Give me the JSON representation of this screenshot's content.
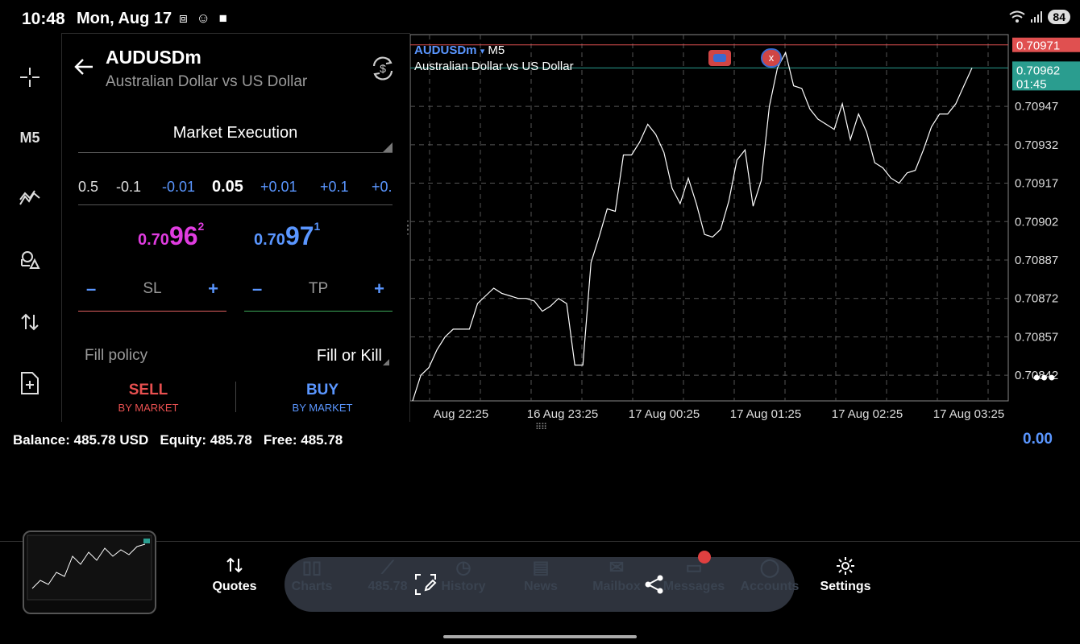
{
  "status_bar": {
    "time": "10:48",
    "date": "Mon, Aug 17",
    "battery": "84"
  },
  "toolbar": {
    "timeframe": "M5"
  },
  "order_panel": {
    "symbol": "AUDUSDm",
    "description": "Australian Dollar vs US Dollar",
    "execution": "Market Execution",
    "volume_steps": [
      "0.5",
      "-0.1",
      "-0.01",
      "0.05",
      "+0.01",
      "+0.1",
      "+0."
    ],
    "bid": {
      "prefix": "0.70",
      "big": "96",
      "sup": "2"
    },
    "ask": {
      "prefix": "0.70",
      "big": "97",
      "sup": "1"
    },
    "sl_label": "SL",
    "tp_label": "TP",
    "minus": "–",
    "plus": "+",
    "fill_policy_label": "Fill policy",
    "fill_policy_value": "Fill or Kill",
    "sell": {
      "label": "SELL",
      "sub": "BY MARKET"
    },
    "buy": {
      "label": "BUY",
      "sub": "BY MARKET"
    }
  },
  "chart_header": {
    "symbol": "AUDUSDm",
    "arrow": "▾",
    "timeframe": "M5",
    "description": "Australian Dollar vs US Dollar"
  },
  "chart_data": {
    "type": "line",
    "y_ticks": [
      "0.70947",
      "0.70932",
      "0.70917",
      "0.70902",
      "0.70887",
      "0.70872",
      "0.70857",
      "0.70842"
    ],
    "y_tick_values": [
      0.70947,
      0.70932,
      0.70917,
      0.70902,
      0.70887,
      0.70872,
      0.70857,
      0.70842
    ],
    "ylim": [
      0.70832,
      0.70975
    ],
    "x_ticks": [
      "Aug 22:25",
      "16 Aug 23:25",
      "17 Aug 00:25",
      "17 Aug 01:25",
      "17 Aug 02:25",
      "17 Aug 03:25"
    ],
    "ask_line": {
      "value": "0.70971",
      "color": "#e05050"
    },
    "bid_line": {
      "value": "0.70962",
      "countdown": "01:45",
      "color": "#2a9d8f"
    },
    "values": [
      0.70832,
      0.70842,
      0.70845,
      0.70852,
      0.70857,
      0.7086,
      0.7086,
      0.7086,
      0.7087,
      0.70873,
      0.70876,
      0.70874,
      0.70873,
      0.70872,
      0.70872,
      0.70871,
      0.70867,
      0.70869,
      0.70872,
      0.7087,
      0.70846,
      0.70846,
      0.70886,
      0.70896,
      0.70907,
      0.70906,
      0.70928,
      0.70928,
      0.70933,
      0.7094,
      0.70936,
      0.70929,
      0.70915,
      0.70909,
      0.70919,
      0.70909,
      0.70897,
      0.70896,
      0.70899,
      0.7091,
      0.70926,
      0.7093,
      0.70908,
      0.70918,
      0.70947,
      0.70962,
      0.70968,
      0.70955,
      0.70954,
      0.70946,
      0.70942,
      0.7094,
      0.70938,
      0.70948,
      0.70934,
      0.70944,
      0.70937,
      0.70925,
      0.70923,
      0.70919,
      0.70917,
      0.70921,
      0.70922,
      0.7093,
      0.70939,
      0.70944,
      0.70944,
      0.70948,
      0.70955,
      0.70962
    ]
  },
  "account": {
    "balance_label": "Balance:",
    "balance": "485.78 USD",
    "equity_label": "Equity:",
    "equity": "485.78",
    "free_label": "Free:",
    "free": "485.78",
    "profit": "0.00"
  },
  "nav": {
    "quotes": "Quotes",
    "charts": "Charts",
    "trade": "485.78",
    "history": "History",
    "news": "News",
    "mailbox": "Mailbox",
    "messages": "Messages",
    "accounts": "Accounts",
    "settings": "Settings"
  }
}
